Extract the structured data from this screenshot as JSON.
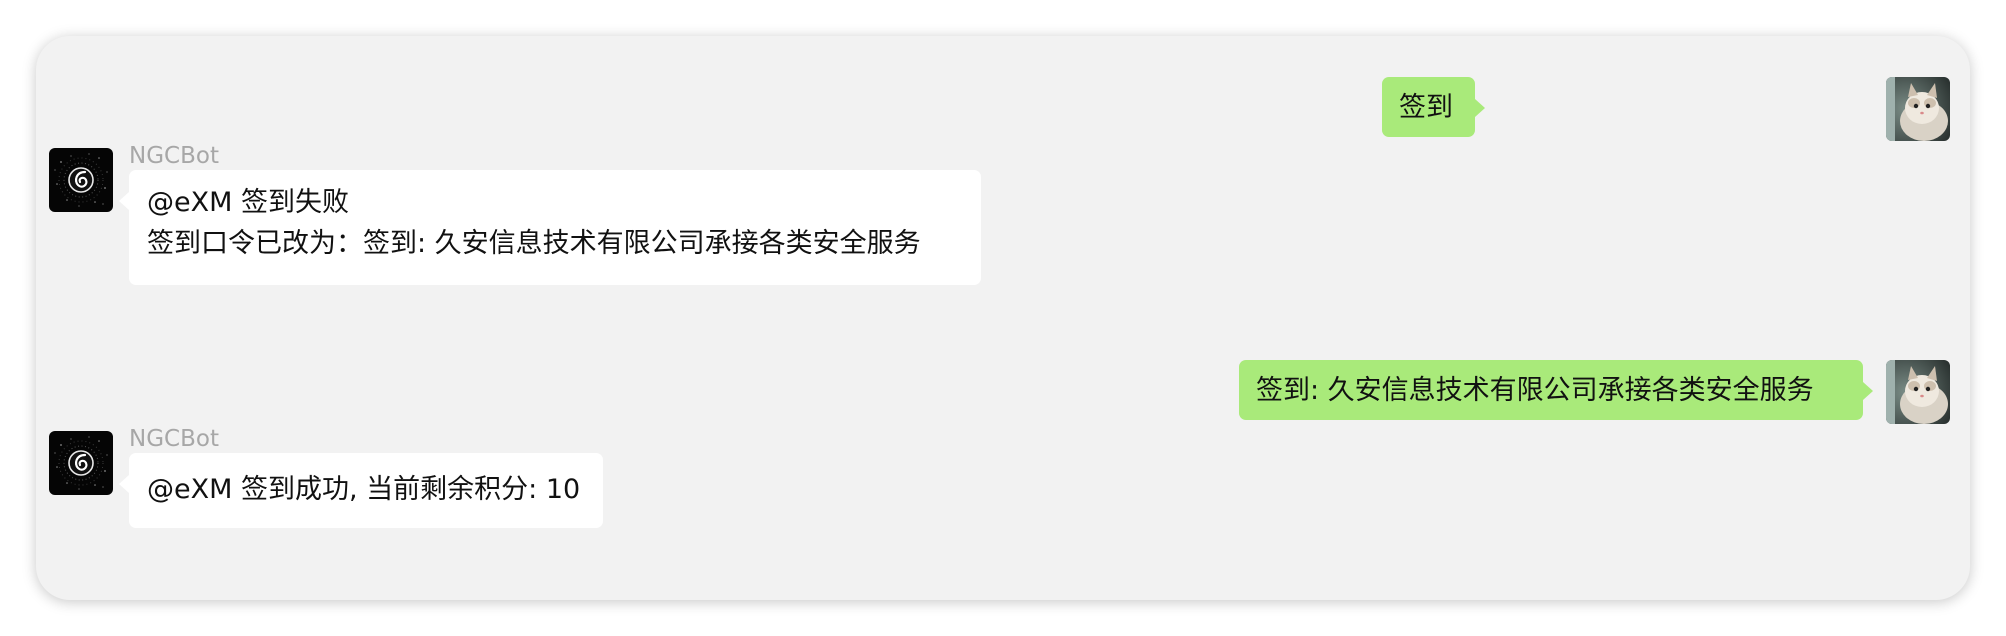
{
  "chat": {
    "messages": [
      {
        "direction": "outgoing",
        "avatar_icon": "cat-avatar-icon",
        "lines": [
          "签到"
        ]
      },
      {
        "direction": "incoming",
        "sender": "NGCBot",
        "avatar_icon": "ngcbot-avatar-icon",
        "lines": [
          "@eXM 签到失败",
          "签到口令已改为：签到: 久安信息技术有限公司承接各类安全服务"
        ]
      },
      {
        "direction": "outgoing",
        "avatar_icon": "cat-avatar-icon",
        "lines": [
          "签到: 久安信息技术有限公司承接各类安全服务"
        ]
      },
      {
        "direction": "incoming",
        "sender": "NGCBot",
        "avatar_icon": "ngcbot-avatar-icon",
        "lines": [
          "@eXM 签到成功, 当前剩余积分: 10"
        ]
      }
    ]
  },
  "colors": {
    "panel_background": "#f2f2f2",
    "outgoing_bubble": "#a9ea7a",
    "incoming_bubble": "#ffffff",
    "sender_name": "#a7a7a7"
  }
}
